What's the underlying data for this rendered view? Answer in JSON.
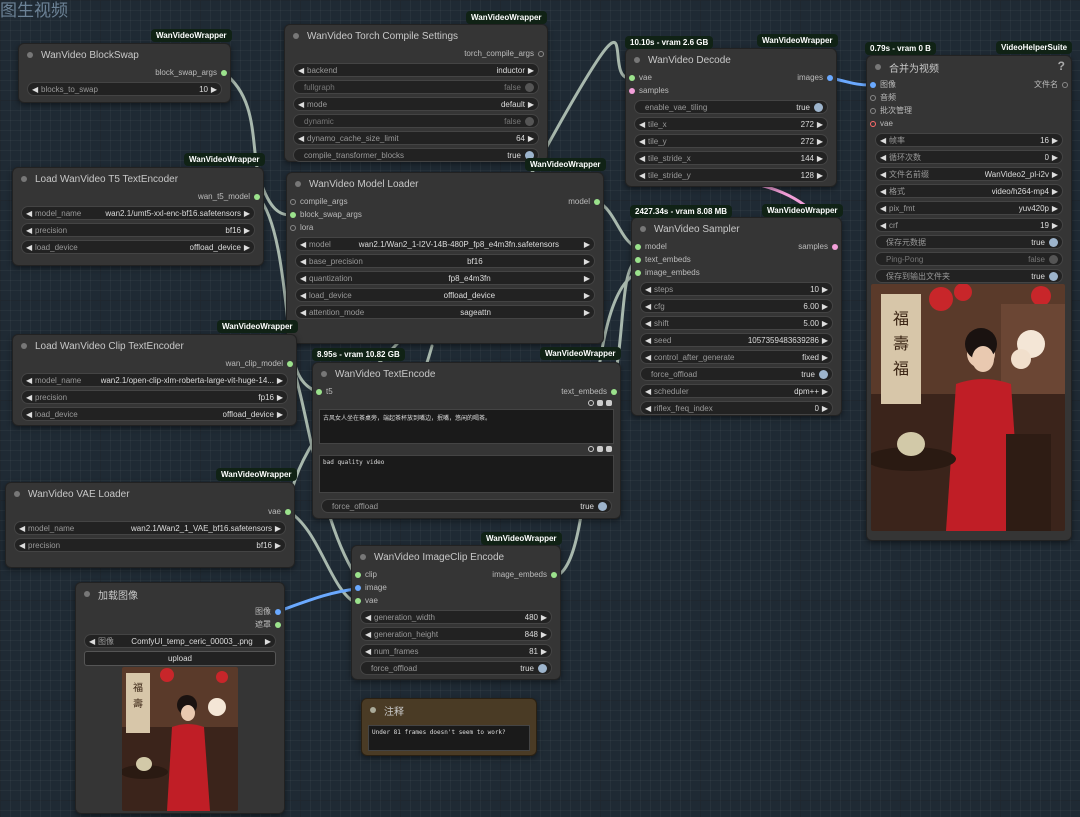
{
  "canvas_title": "图生视频",
  "badges": {
    "blockswap": "WanVideoWrapper",
    "torch": "WanVideoWrapper",
    "decode_time": "10.10s - vram 2.6 GB",
    "decode": "WanVideoWrapper",
    "combine_time": "0.79s - vram 0 B",
    "combine": "VideoHelperSuite",
    "t5": "WanVideoWrapper",
    "loader": "WanVideoWrapper",
    "sampler_time": "2427.34s - vram 8.08 MB",
    "sampler": "WanVideoWrapper",
    "clip": "WanVideoWrapper",
    "textenc_time": "8.95s - vram 10.82 GB",
    "textenc": "WanVideoWrapper",
    "vae": "WanVideoWrapper",
    "imgclip": "WanVideoWrapper"
  },
  "nodes": {
    "blockswap": {
      "title": "WanVideo BlockSwap",
      "out": "block_swap_args",
      "w_label": "blocks_to_swap",
      "w_value": "10"
    },
    "torch": {
      "title": "WanVideo Torch Compile Settings",
      "out": "torch_compile_args",
      "widgets": [
        {
          "label": "backend",
          "value": "inductor"
        },
        {
          "label": "fullgraph",
          "value": "false"
        },
        {
          "label": "mode",
          "value": "default"
        },
        {
          "label": "dynamic",
          "value": "false"
        },
        {
          "label": "dynamo_cache_size_limit",
          "value": "64"
        },
        {
          "label": "compile_transformer_blocks",
          "value": "true"
        }
      ]
    },
    "decode": {
      "title": "WanVideo Decode",
      "in_vae": "vae",
      "in_samples": "samples",
      "out": "images",
      "widgets": [
        {
          "label": "enable_vae_tiling",
          "value": "true"
        },
        {
          "label": "tile_x",
          "value": "272"
        },
        {
          "label": "tile_y",
          "value": "272"
        },
        {
          "label": "tile_stride_x",
          "value": "144"
        },
        {
          "label": "tile_stride_y",
          "value": "128"
        }
      ]
    },
    "combine": {
      "title": "合并为视频",
      "help": "?",
      "in_images": "图像",
      "in_audio": "音频",
      "in_batch": "批次管理",
      "in_vae": "vae",
      "out": "文件名",
      "widgets": [
        {
          "label": "帧率",
          "value": "16"
        },
        {
          "label": "循环次数",
          "value": "0"
        },
        {
          "label": "文件名前缀",
          "value": "WanVideo2_pl-i2v"
        },
        {
          "label": "格式",
          "value": "video/h264-mp4"
        },
        {
          "label": "pix_fmt",
          "value": "yuv420p"
        },
        {
          "label": "crf",
          "value": "19"
        },
        {
          "label": "保存元数据",
          "value": "true"
        },
        {
          "label": "Ping-Pong",
          "value": "false"
        },
        {
          "label": "保存到输出文件夹",
          "value": "true"
        }
      ]
    },
    "t5": {
      "title": "Load WanVideo T5 TextEncoder",
      "out": "wan_t5_model",
      "widgets": [
        {
          "label": "model_name",
          "value": "wan2.1/umt5-xxl-enc-bf16.safetensors"
        },
        {
          "label": "precision",
          "value": "bf16"
        },
        {
          "label": "load_device",
          "value": "offload_device"
        }
      ]
    },
    "loader": {
      "title": "WanVideo Model Loader",
      "in1": "compile_args",
      "in2": "block_swap_args",
      "in3": "lora",
      "out": "model",
      "widgets": [
        {
          "label": "model",
          "value": "wan2.1/Wan2_1-I2V-14B-480P_fp8_e4m3fn.safetensors"
        },
        {
          "label": "base_precision",
          "value": "bf16"
        },
        {
          "label": "quantization",
          "value": "fp8_e4m3fn"
        },
        {
          "label": "load_device",
          "value": "offload_device"
        },
        {
          "label": "attention_mode",
          "value": "sageattn"
        }
      ]
    },
    "sampler": {
      "title": "WanVideo Sampler",
      "in1": "model",
      "in2": "text_embeds",
      "in3": "image_embeds",
      "out": "samples",
      "widgets": [
        {
          "label": "steps",
          "value": "10"
        },
        {
          "label": "cfg",
          "value": "6.00"
        },
        {
          "label": "shift",
          "value": "5.00"
        },
        {
          "label": "seed",
          "value": "1057359483639286"
        },
        {
          "label": "control_after_generate",
          "value": "fixed"
        },
        {
          "label": "force_offload",
          "value": "true"
        },
        {
          "label": "scheduler",
          "value": "dpm++"
        },
        {
          "label": "riflex_freq_index",
          "value": "0"
        }
      ]
    },
    "clip": {
      "title": "Load WanVideo Clip TextEncoder",
      "out": "wan_clip_model",
      "widgets": [
        {
          "label": "model_name",
          "value": "wan2.1/open-clip-xlm-roberta-large-vit-huge-14..."
        },
        {
          "label": "precision",
          "value": "fp16"
        },
        {
          "label": "load_device",
          "value": "offload_device"
        }
      ]
    },
    "textenc": {
      "title": "WanVideo TextEncode",
      "in1": "t5",
      "out": "text_embeds",
      "positive": "古风女人坐在茶桌旁，端起茶杯放到嘴边，抿嘴，悠闲的喝茶。",
      "negative": "bad quality video",
      "force_label": "force_offload",
      "force_value": "true"
    },
    "vae": {
      "title": "WanVideo VAE Loader",
      "out": "vae",
      "widgets": [
        {
          "label": "model_name",
          "value": "wan2.1/Wan2_1_VAE_bf16.safetensors"
        },
        {
          "label": "precision",
          "value": "bf16"
        }
      ]
    },
    "imgclip": {
      "title": "WanVideo ImageClip Encode",
      "in1": "clip",
      "in2": "image",
      "in3": "vae",
      "out": "image_embeds",
      "widgets": [
        {
          "label": "generation_width",
          "value": "480"
        },
        {
          "label": "generation_height",
          "value": "848"
        },
        {
          "label": "num_frames",
          "value": "81"
        },
        {
          "label": "force_offload",
          "value": "true"
        }
      ]
    },
    "loadimg": {
      "title": "加载图像",
      "out1": "图像",
      "out2": "遮罩",
      "w_label": "图像",
      "w_value": "ComfyUI_temp_ceric_00003_.png",
      "upload": "upload"
    },
    "note": {
      "title": "注释",
      "text": "Under 81 frames doesn't seem to work?"
    }
  },
  "colors": {
    "accent_green": "#9be28c",
    "pink": "#f29fd9",
    "blue": "#6aa9ff",
    "node_bg": "#353535",
    "canvas": "#1f2a34"
  }
}
